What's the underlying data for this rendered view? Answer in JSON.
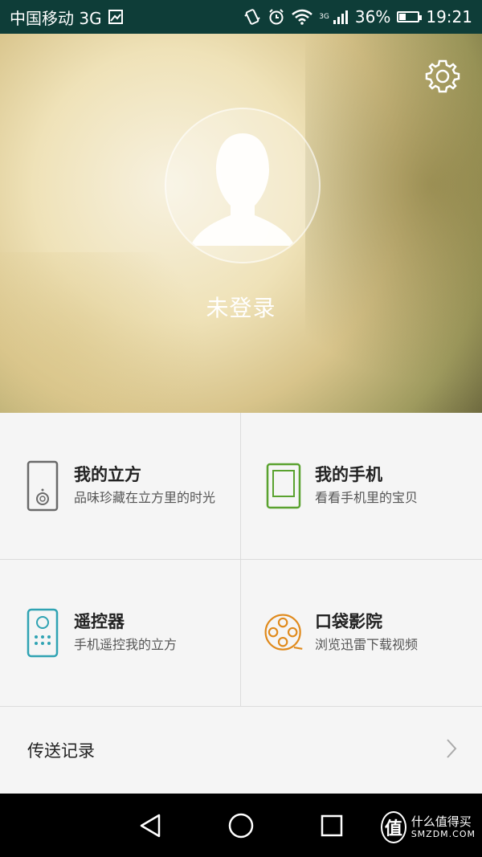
{
  "status_bar": {
    "carrier": "中国移动 3G",
    "network_small": "3G",
    "battery_percent": "36%",
    "battery_level": 0.36,
    "time": "19:21"
  },
  "profile": {
    "login_status": "未登录"
  },
  "grid": [
    {
      "title": "我的立方",
      "subtitle": "品味珍藏在立方里的时光",
      "icon": "device-icon",
      "color": "#6a6a6a"
    },
    {
      "title": "我的手机",
      "subtitle": "看看手机里的宝贝",
      "icon": "phone-icon",
      "color": "#5aa22f"
    },
    {
      "title": "遥控器",
      "subtitle": "手机遥控我的立方",
      "icon": "remote-icon",
      "color": "#2fa3b3"
    },
    {
      "title": "口袋影院",
      "subtitle": "浏览迅雷下载视频",
      "icon": "film-reel-icon",
      "color": "#e08a1c"
    }
  ],
  "records": {
    "label": "传送记录"
  },
  "watermark": {
    "badge": "值",
    "cn": "什么值得买",
    "en": "SMZDM.COM"
  }
}
